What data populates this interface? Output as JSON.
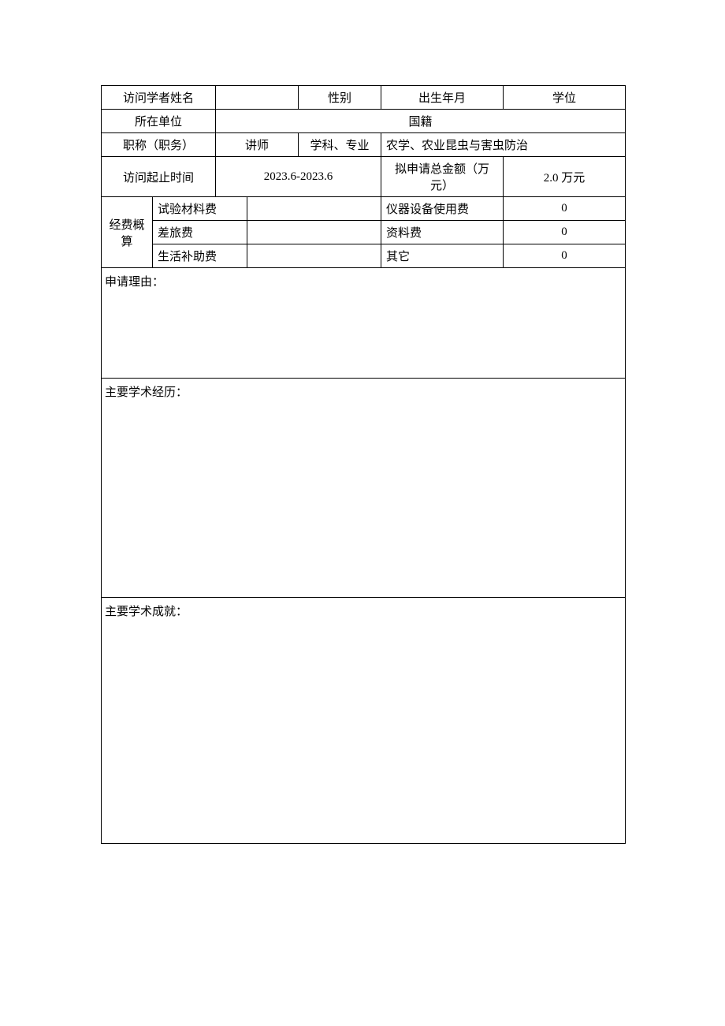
{
  "labels": {
    "visitor_name": "访问学者姓名",
    "gender": "性别",
    "birth_date": "出生年月",
    "degree": "学位",
    "affiliation": "所在单位",
    "nationality": "国籍",
    "title_position": "职称（职务）",
    "subject_major": "学科、专业",
    "visit_period": "访问起止时间",
    "total_amount": "拟申请总金额（万元）",
    "budget_estimate": "经费概算",
    "material_fee": "试验材料费",
    "equipment_fee": "仪器设备使用费",
    "travel_fee": "差旅费",
    "document_fee": "资料费",
    "living_subsidy": "生活补助费",
    "other": "其它",
    "application_reason": "申请理由：",
    "academic_history": "主要学术经历：",
    "academic_achievements": "主要学术成就："
  },
  "values": {
    "visitor_name": "",
    "gender": "",
    "birth_date": "",
    "degree": "",
    "affiliation": "",
    "nationality": "",
    "title_position": "讲师",
    "subject_major": "农学、农业昆虫与害虫防治",
    "visit_period": "2023.6-2023.6",
    "total_amount": "2.0 万元",
    "material_fee": "",
    "equipment_fee": "0",
    "travel_fee": "",
    "document_fee": "0",
    "living_subsidy": "",
    "other": "0",
    "application_reason": "",
    "academic_history": "",
    "academic_achievements": ""
  }
}
